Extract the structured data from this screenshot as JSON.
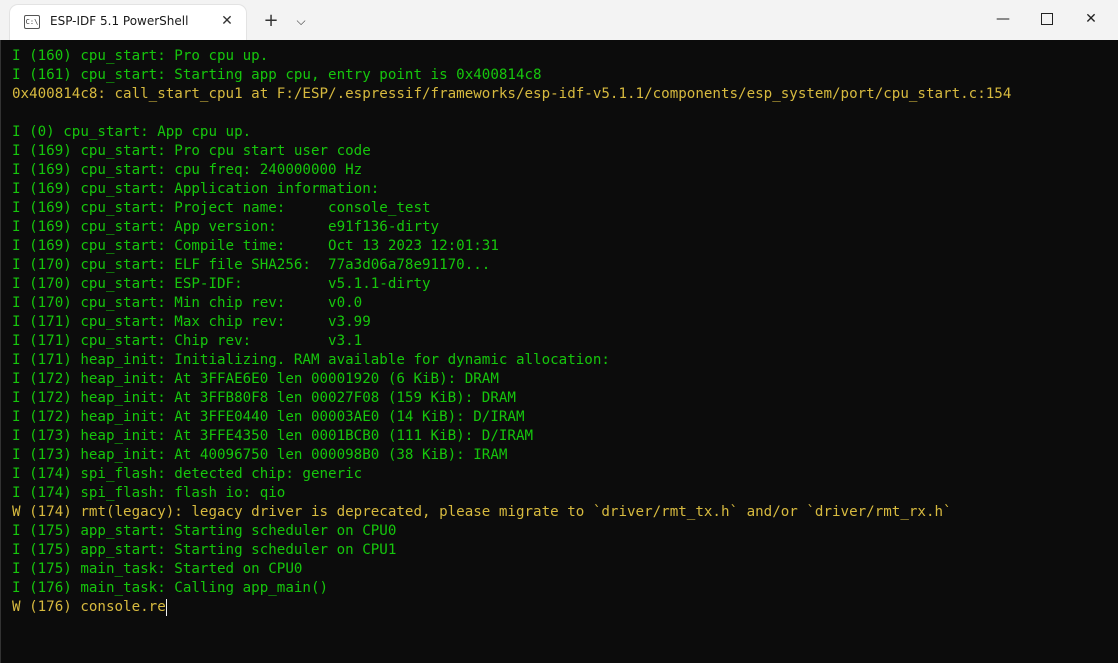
{
  "window": {
    "tab_title": "ESP-IDF 5.1 PowerShell",
    "tab_close": "✕",
    "new_tab": "+",
    "dropdown": "⌵",
    "min": "—",
    "close": "✕"
  },
  "colors": {
    "info": "#16c60c",
    "warn": "#d7ba3f",
    "background": "#0c0c0c"
  },
  "lines": [
    {
      "text": "I (160) cpu_start: Pro cpu up.",
      "level": "info"
    },
    {
      "text": "I (161) cpu_start: Starting app cpu, entry point is 0x400814c8",
      "level": "info"
    },
    {
      "text": "0x400814c8: call_start_cpu1 at F:/ESP/.espressif/frameworks/esp-idf-v5.1.1/components/esp_system/port/cpu_start.c:154",
      "level": "warn"
    },
    {
      "text": "",
      "level": "info"
    },
    {
      "text": "I (0) cpu_start: App cpu up.",
      "level": "info"
    },
    {
      "text": "I (169) cpu_start: Pro cpu start user code",
      "level": "info"
    },
    {
      "text": "I (169) cpu_start: cpu freq: 240000000 Hz",
      "level": "info"
    },
    {
      "text": "I (169) cpu_start: Application information:",
      "level": "info"
    },
    {
      "text": "I (169) cpu_start: Project name:     console_test",
      "level": "info"
    },
    {
      "text": "I (169) cpu_start: App version:      e91f136-dirty",
      "level": "info"
    },
    {
      "text": "I (169) cpu_start: Compile time:     Oct 13 2023 12:01:31",
      "level": "info"
    },
    {
      "text": "I (170) cpu_start: ELF file SHA256:  77a3d06a78e91170...",
      "level": "info"
    },
    {
      "text": "I (170) cpu_start: ESP-IDF:          v5.1.1-dirty",
      "level": "info"
    },
    {
      "text": "I (170) cpu_start: Min chip rev:     v0.0",
      "level": "info"
    },
    {
      "text": "I (171) cpu_start: Max chip rev:     v3.99",
      "level": "info"
    },
    {
      "text": "I (171) cpu_start: Chip rev:         v3.1",
      "level": "info"
    },
    {
      "text": "I (171) heap_init: Initializing. RAM available for dynamic allocation:",
      "level": "info"
    },
    {
      "text": "I (172) heap_init: At 3FFAE6E0 len 00001920 (6 KiB): DRAM",
      "level": "info"
    },
    {
      "text": "I (172) heap_init: At 3FFB80F8 len 00027F08 (159 KiB): DRAM",
      "level": "info"
    },
    {
      "text": "I (172) heap_init: At 3FFE0440 len 00003AE0 (14 KiB): D/IRAM",
      "level": "info"
    },
    {
      "text": "I (173) heap_init: At 3FFE4350 len 0001BCB0 (111 KiB): D/IRAM",
      "level": "info"
    },
    {
      "text": "I (173) heap_init: At 40096750 len 000098B0 (38 KiB): IRAM",
      "level": "info"
    },
    {
      "text": "I (174) spi_flash: detected chip: generic",
      "level": "info"
    },
    {
      "text": "I (174) spi_flash: flash io: qio",
      "level": "info"
    },
    {
      "text": "W (174) rmt(legacy): legacy driver is deprecated, please migrate to `driver/rmt_tx.h` and/or `driver/rmt_rx.h`",
      "level": "warn"
    },
    {
      "text": "I (175) app_start: Starting scheduler on CPU0",
      "level": "info"
    },
    {
      "text": "I (175) app_start: Starting scheduler on CPU1",
      "level": "info"
    },
    {
      "text": "I (175) main_task: Started on CPU0",
      "level": "info"
    },
    {
      "text": "I (176) main_task: Calling app_main()",
      "level": "info"
    },
    {
      "text": "W (176) console.re",
      "level": "warn"
    }
  ]
}
